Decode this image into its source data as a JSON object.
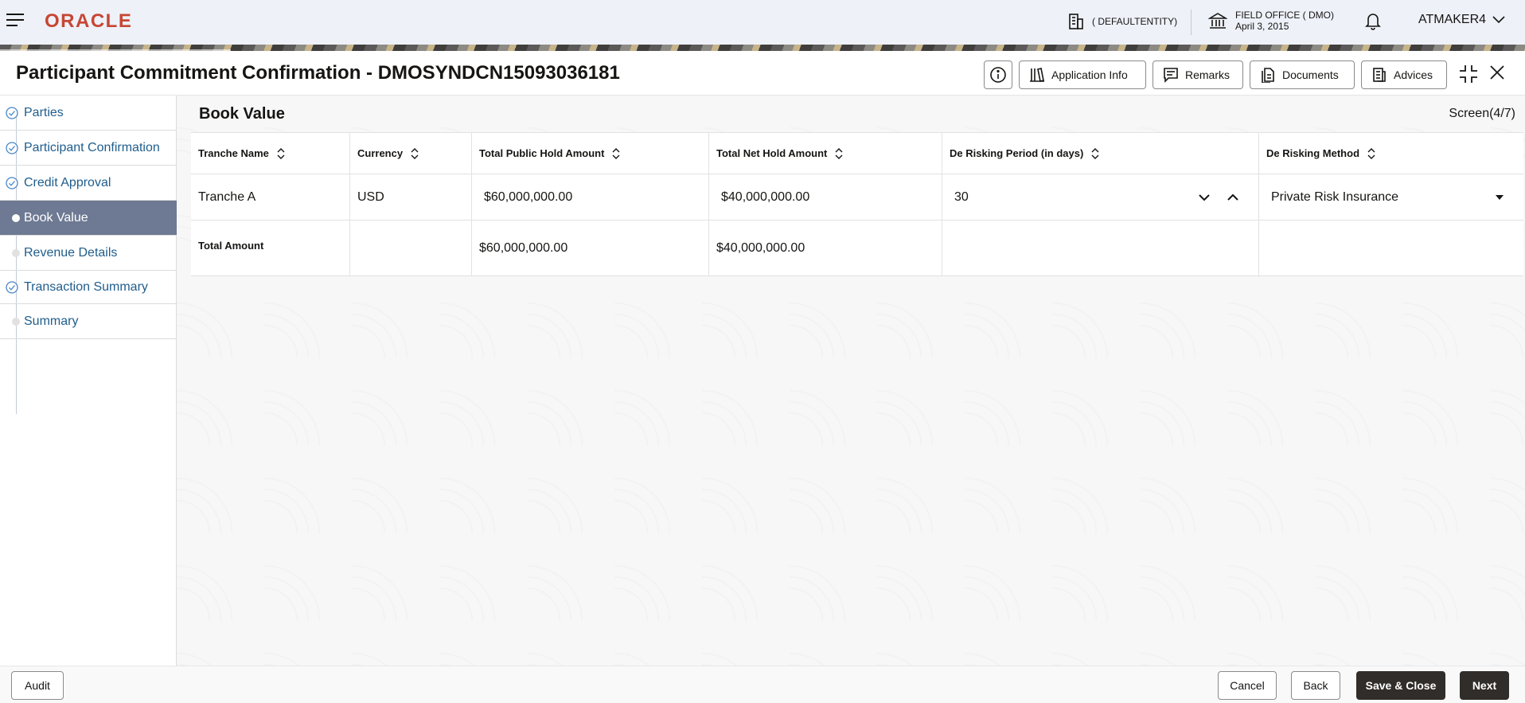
{
  "topbar": {
    "logo": "ORACLE",
    "entity": "( DEFAULTENTITY)",
    "office_name": "FIELD OFFICE ( DMO)",
    "office_date": "April 3, 2015",
    "user": "ATMAKER4"
  },
  "header": {
    "title": "Participant Commitment Confirmation - DMOSYNDCN15093036181",
    "buttons": {
      "application_info": "Application Info",
      "remarks": "Remarks",
      "documents": "Documents",
      "advices": "Advices"
    }
  },
  "sidebar": {
    "items": [
      {
        "label": "Parties",
        "state": "completed"
      },
      {
        "label": "Participant Confirmation",
        "state": "completed"
      },
      {
        "label": "Credit Approval",
        "state": "completed"
      },
      {
        "label": "Book Value",
        "state": "active"
      },
      {
        "label": "Revenue Details",
        "state": "pending"
      },
      {
        "label": "Transaction Summary",
        "state": "completed"
      },
      {
        "label": "Summary",
        "state": "pending"
      }
    ]
  },
  "main": {
    "section_title": "Book Value",
    "screen_indicator": "Screen(4/7)",
    "table": {
      "columns": [
        "Tranche Name",
        "Currency",
        "Total Public Hold Amount",
        "Total Net Hold Amount",
        "De Risking Period (in days)",
        "De Risking Method"
      ],
      "rows": [
        {
          "tranche_name": "Tranche A",
          "currency": "USD",
          "total_public_hold_amount": "$60,000,000.00",
          "total_net_hold_amount": "$40,000,000.00",
          "de_risking_period": "30",
          "de_risking_method": "Private Risk Insurance"
        }
      ],
      "total": {
        "label": "Total Amount",
        "total_public_hold_amount": "$60,000,000.00",
        "total_net_hold_amount": "$40,000,000.00"
      }
    }
  },
  "footer": {
    "audit": "Audit",
    "cancel": "Cancel",
    "back": "Back",
    "save_close": "Save & Close",
    "next": "Next"
  },
  "colors": {
    "brand_red": "#c74634",
    "active_step": "#6e7a93",
    "primary_button": "#312d2a",
    "link_blue": "#1f5d8c"
  }
}
